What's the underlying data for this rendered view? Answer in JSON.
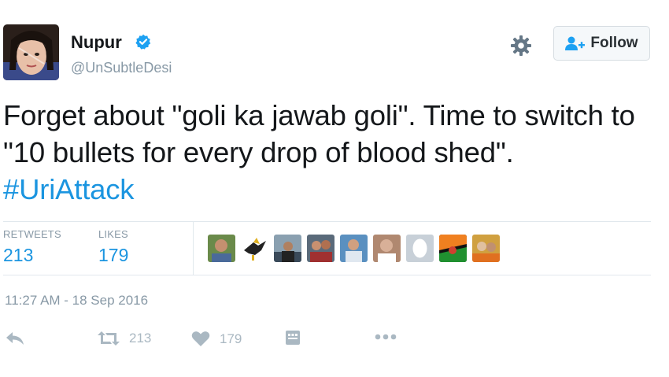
{
  "user": {
    "name": "Nupur",
    "handle": "@UnSubtleDesi",
    "verified": true
  },
  "follow_button": {
    "label": "Follow",
    "icon": "follow-user-icon"
  },
  "tweet": {
    "text_before": "Forget about \"goli ka jawab goli\". Time to switch to \"10 bullets for every drop of blood shed\". ",
    "hashtag": "#UriAttack"
  },
  "stats": {
    "retweets_label": "RETWEETS",
    "retweets": "213",
    "likes_label": "LIKES",
    "likes": "179"
  },
  "liked_by_avatars": 9,
  "timestamp": "11:27 AM - 18 Sep 2016",
  "actions": {
    "retweet_count": "213",
    "like_count": "179"
  },
  "colors": {
    "link_blue": "#1b95e0",
    "muted_gray": "#8899a6",
    "action_gray": "#aab8c2",
    "text": "#14171a"
  }
}
